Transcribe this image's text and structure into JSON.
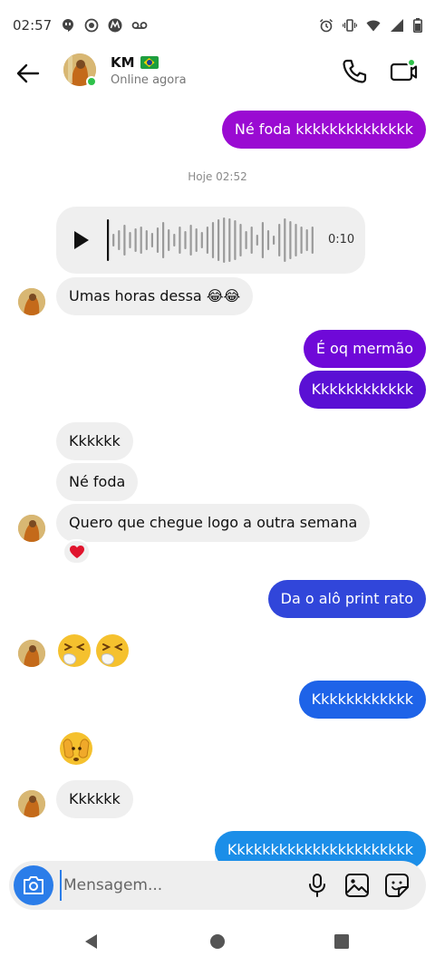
{
  "status_bar": {
    "time": "02:57",
    "left_icons": [
      "hangouts-icon",
      "target-icon",
      "motorola-icon",
      "voicemail-icon"
    ],
    "right_icons": [
      "alarm-icon",
      "vibrate-icon",
      "wifi-icon",
      "signal-icon",
      "battery-icon"
    ]
  },
  "header": {
    "contact_name": "KM",
    "contact_flag": "brazil-flag",
    "contact_status": "Online agora",
    "online_color": "#2ec14a"
  },
  "conversation": {
    "timestamp": "Hoje 02:52",
    "messages": [
      {
        "id": "m1",
        "direction": "out",
        "text": "Né foda kkkkkkkkkkkkkk",
        "color": "#9a0bd2"
      },
      {
        "id": "m2",
        "direction": "in",
        "type": "audio",
        "duration": "0:10"
      },
      {
        "id": "m3",
        "direction": "in",
        "text": "Umas horas dessa 😂😂"
      },
      {
        "id": "m4",
        "direction": "out",
        "text": "É oq mermão",
        "color": "#6f09d8"
      },
      {
        "id": "m5",
        "direction": "out",
        "text": "Kkkkkkkkkkkk",
        "color": "#5a10d4"
      },
      {
        "id": "m6",
        "direction": "in",
        "text": "Kkkkkk"
      },
      {
        "id": "m7",
        "direction": "in",
        "text": "Né foda"
      },
      {
        "id": "m8",
        "direction": "in",
        "text": "Quero que chegue logo a outra semana",
        "reaction": "heart"
      },
      {
        "id": "m9",
        "direction": "out",
        "text": "Da o alô print rato",
        "color": "#3146da"
      },
      {
        "id": "m10",
        "direction": "in",
        "type": "emoji",
        "emoji": "sneezing-face x2"
      },
      {
        "id": "m11",
        "direction": "out",
        "text": "Kkkkkkkkkkkk",
        "color": "#1e63e8"
      },
      {
        "id": "m12",
        "direction": "in",
        "type": "emoji",
        "emoji": "face-with-peeking-eye"
      },
      {
        "id": "m13",
        "direction": "in",
        "text": "Kkkkkk"
      },
      {
        "id": "m14",
        "direction": "out",
        "text": "Kkkkkkkkkkkkkkkkkkkkkk",
        "color": "#1b8ee8"
      }
    ]
  },
  "composer": {
    "placeholder": "Mensagem...",
    "accent": "#2b7de9"
  },
  "nav": {
    "buttons": [
      "back-triangle-icon",
      "home-circle-icon",
      "recents-square-icon"
    ]
  }
}
